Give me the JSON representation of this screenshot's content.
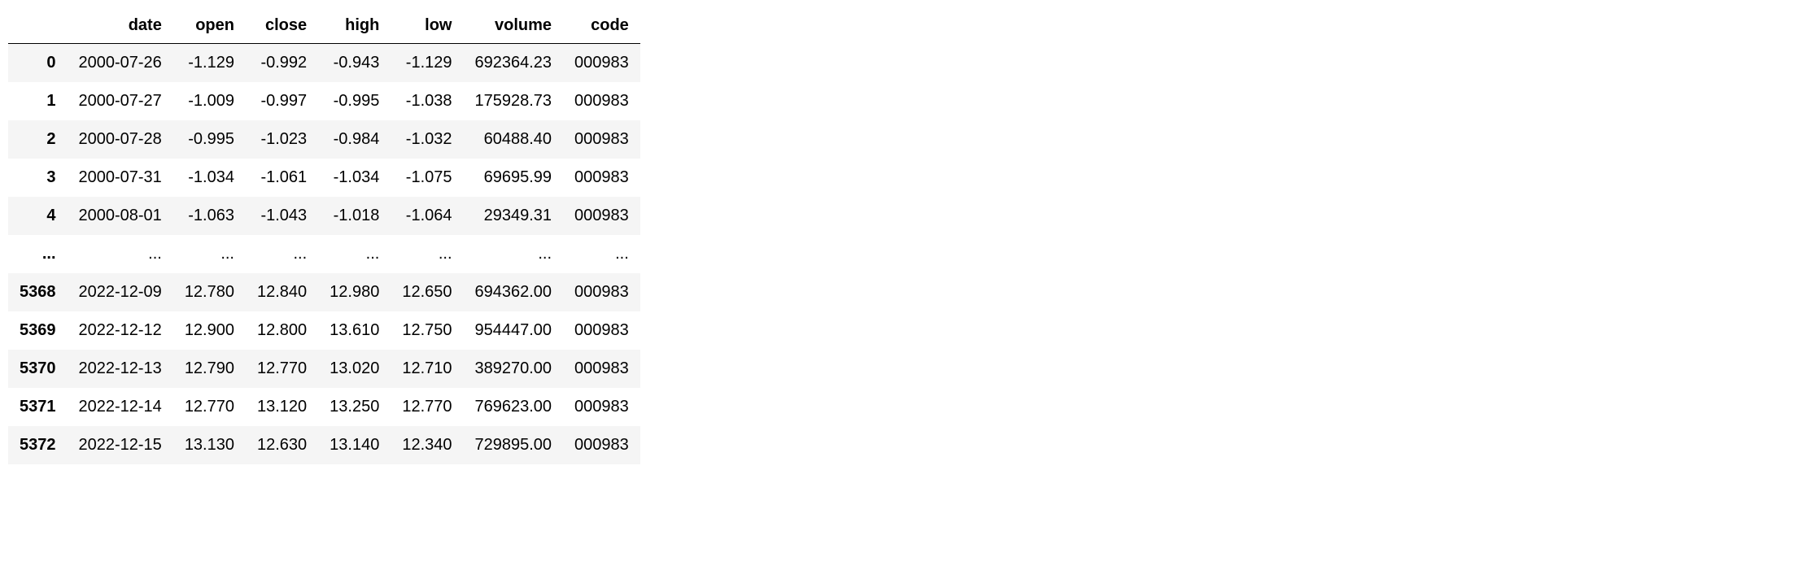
{
  "columns": [
    "",
    "date",
    "open",
    "close",
    "high",
    "low",
    "volume",
    "code"
  ],
  "rows": [
    {
      "index": "0",
      "date": "2000-07-26",
      "open": "-1.129",
      "close": "-0.992",
      "high": "-0.943",
      "low": "-1.129",
      "volume": "692364.23",
      "code": "000983"
    },
    {
      "index": "1",
      "date": "2000-07-27",
      "open": "-1.009",
      "close": "-0.997",
      "high": "-0.995",
      "low": "-1.038",
      "volume": "175928.73",
      "code": "000983"
    },
    {
      "index": "2",
      "date": "2000-07-28",
      "open": "-0.995",
      "close": "-1.023",
      "high": "-0.984",
      "low": "-1.032",
      "volume": "60488.40",
      "code": "000983"
    },
    {
      "index": "3",
      "date": "2000-07-31",
      "open": "-1.034",
      "close": "-1.061",
      "high": "-1.034",
      "low": "-1.075",
      "volume": "69695.99",
      "code": "000983"
    },
    {
      "index": "4",
      "date": "2000-08-01",
      "open": "-1.063",
      "close": "-1.043",
      "high": "-1.018",
      "low": "-1.064",
      "volume": "29349.31",
      "code": "000983"
    },
    {
      "index": "...",
      "date": "...",
      "open": "...",
      "close": "...",
      "high": "...",
      "low": "...",
      "volume": "...",
      "code": "..."
    },
    {
      "index": "5368",
      "date": "2022-12-09",
      "open": "12.780",
      "close": "12.840",
      "high": "12.980",
      "low": "12.650",
      "volume": "694362.00",
      "code": "000983"
    },
    {
      "index": "5369",
      "date": "2022-12-12",
      "open": "12.900",
      "close": "12.800",
      "high": "13.610",
      "low": "12.750",
      "volume": "954447.00",
      "code": "000983"
    },
    {
      "index": "5370",
      "date": "2022-12-13",
      "open": "12.790",
      "close": "12.770",
      "high": "13.020",
      "low": "12.710",
      "volume": "389270.00",
      "code": "000983"
    },
    {
      "index": "5371",
      "date": "2022-12-14",
      "open": "12.770",
      "close": "13.120",
      "high": "13.250",
      "low": "12.770",
      "volume": "769623.00",
      "code": "000983"
    },
    {
      "index": "5372",
      "date": "2022-12-15",
      "open": "13.130",
      "close": "12.630",
      "high": "13.140",
      "low": "12.340",
      "volume": "729895.00",
      "code": "000983"
    }
  ]
}
